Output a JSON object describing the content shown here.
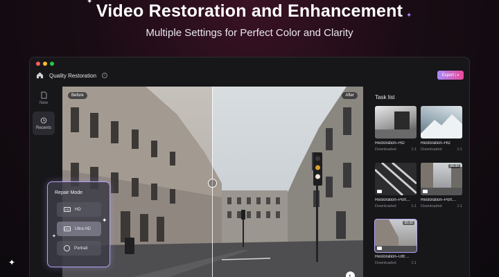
{
  "hero": {
    "title": "Video Restoration and Enhancement",
    "subtitle": "Multiple Settings for Perfect Color and Clarity"
  },
  "window": {
    "title": "Quality Restoration",
    "export_label": "Export",
    "traffic_colors": [
      "#ff5f57",
      "#febc2e",
      "#28c840"
    ]
  },
  "rail": {
    "items": [
      {
        "label": "New",
        "icon": "file-icon"
      },
      {
        "label": "Recents",
        "icon": "history-icon"
      }
    ]
  },
  "preview": {
    "before_label": "Before",
    "after_label": "After"
  },
  "repair_mode": {
    "title": "Repair Mode",
    "modes": [
      {
        "label": "HD",
        "icon": "hd-icon",
        "active": false
      },
      {
        "label": "Ultra HD",
        "icon": "ultra-hd-icon",
        "active": true
      },
      {
        "label": "Portrait",
        "icon": "face-icon",
        "active": false
      }
    ]
  },
  "tasks": {
    "title": "Task list",
    "items": [
      {
        "name": "Restoration–HD",
        "status": "Downloaded",
        "count": "1:1",
        "duration": ""
      },
      {
        "name": "Restoration–HD",
        "status": "Downloaded",
        "count": "1:1",
        "duration": ""
      },
      {
        "name": "Restoration–Port…",
        "status": "Downloaded",
        "count": "1:1",
        "duration": ""
      },
      {
        "name": "Restoration–Port…",
        "status": "Downloaded",
        "count": "1:1",
        "duration": "00:30"
      },
      {
        "name": "Restoration–Ultr…",
        "status": "Downloaded",
        "count": "1:1",
        "duration": "00:30"
      }
    ]
  },
  "colors": {
    "accent_start": "#a78bfa",
    "accent_end": "#ec4899",
    "window_bg": "#17171a"
  }
}
